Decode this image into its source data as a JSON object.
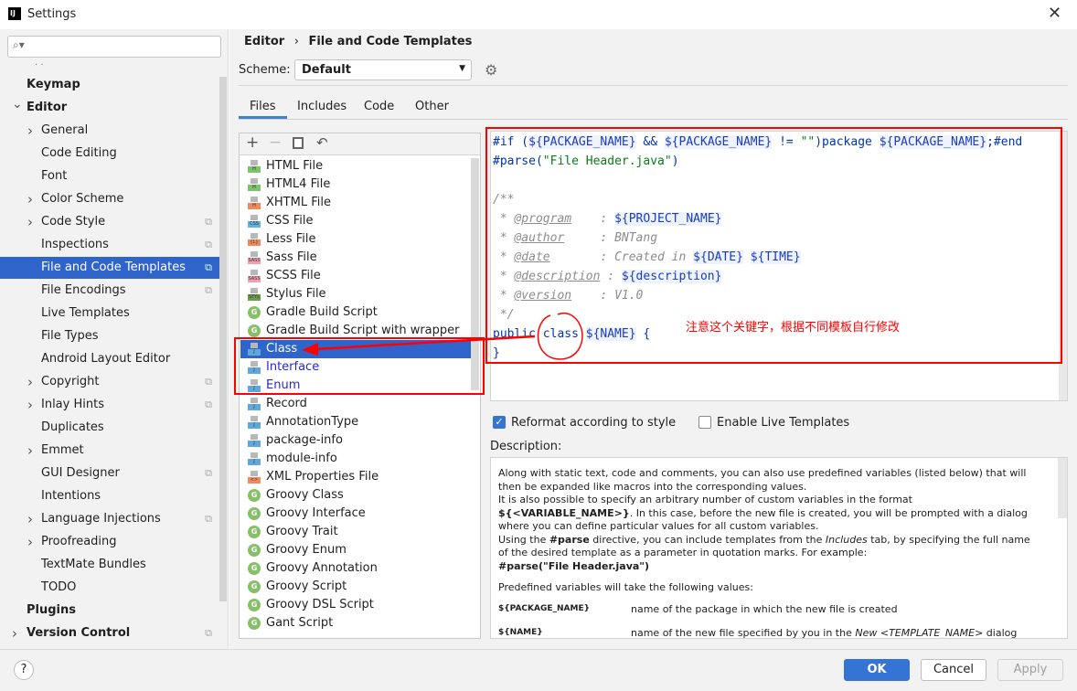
{
  "window": {
    "title": "Settings",
    "close_icon": "close-icon",
    "app_icon": "intellij-icon"
  },
  "search": {
    "placeholder": "",
    "icon": "search-icon"
  },
  "sidebar": {
    "items": [
      {
        "label": "Keymap",
        "bold": true,
        "level": 0
      },
      {
        "label": "Editor",
        "bold": true,
        "level": 0,
        "expanded": true
      },
      {
        "label": "General",
        "level": 1,
        "chevron": true
      },
      {
        "label": "Code Editing",
        "level": 1
      },
      {
        "label": "Font",
        "level": 1
      },
      {
        "label": "Color Scheme",
        "level": 1,
        "chevron": true
      },
      {
        "label": "Code Style",
        "level": 1,
        "chevron": true,
        "project": true
      },
      {
        "label": "Inspections",
        "level": 1,
        "project": true
      },
      {
        "label": "File and Code Templates",
        "level": 1,
        "project": true,
        "selected": true
      },
      {
        "label": "File Encodings",
        "level": 1,
        "project": true
      },
      {
        "label": "Live Templates",
        "level": 1
      },
      {
        "label": "File Types",
        "level": 1
      },
      {
        "label": "Android Layout Editor",
        "level": 1
      },
      {
        "label": "Copyright",
        "level": 1,
        "chevron": true,
        "project": true
      },
      {
        "label": "Inlay Hints",
        "level": 1,
        "chevron": true,
        "project": true
      },
      {
        "label": "Duplicates",
        "level": 1
      },
      {
        "label": "Emmet",
        "level": 1,
        "chevron": true
      },
      {
        "label": "GUI Designer",
        "level": 1,
        "project": true
      },
      {
        "label": "Intentions",
        "level": 1
      },
      {
        "label": "Language Injections",
        "level": 1,
        "chevron": true,
        "project": true
      },
      {
        "label": "Proofreading",
        "level": 1,
        "chevron": true
      },
      {
        "label": "TextMate Bundles",
        "level": 1
      },
      {
        "label": "TODO",
        "level": 1
      },
      {
        "label": "Plugins",
        "bold": true,
        "level": 0
      },
      {
        "label": "Version Control",
        "bold": true,
        "level": 0,
        "chevron": true,
        "project": true
      }
    ]
  },
  "breadcrumb": {
    "parent": "Editor",
    "separator": "›",
    "current": "File and Code Templates"
  },
  "scheme": {
    "label": "Scheme:",
    "value": "Default"
  },
  "tabs": [
    {
      "label": "Files",
      "active": true
    },
    {
      "label": "Includes"
    },
    {
      "label": "Code"
    },
    {
      "label": "Other"
    }
  ],
  "toolbar": {
    "add": "+",
    "remove": "−",
    "copy_icon": "copy-icon",
    "reset_icon": "undo-icon"
  },
  "templates": [
    {
      "label": "HTML File",
      "icon": "H",
      "color": "#7cc46a"
    },
    {
      "label": "HTML4 File",
      "icon": "H",
      "color": "#7cc46a"
    },
    {
      "label": "XHTML File",
      "icon": "H",
      "color": "#f08a5d"
    },
    {
      "label": "CSS File",
      "icon": "CSS",
      "color": "#5fb4d8"
    },
    {
      "label": "Less File",
      "icon": "{L}",
      "color": "#f08a5d"
    },
    {
      "label": "Sass File",
      "icon": "SASS",
      "color": "#f2a0b0"
    },
    {
      "label": "SCSS File",
      "icon": "SASS",
      "color": "#f2a0b0"
    },
    {
      "label": "Stylus File",
      "icon": "STYL",
      "color": "#6a9f4a"
    },
    {
      "label": "Gradle Build Script",
      "icon": "G",
      "type": "groovy"
    },
    {
      "label": "Gradle Build Script with wrapper",
      "icon": "G",
      "type": "groovy"
    },
    {
      "label": "Class",
      "icon": "J",
      "color": "#5fa8d8",
      "selected": true
    },
    {
      "label": "Interface",
      "icon": "J",
      "color": "#5fa8d8",
      "blue": true
    },
    {
      "label": "Enum",
      "icon": "J",
      "color": "#5fa8d8",
      "blue": true
    },
    {
      "label": "Record",
      "icon": "J",
      "color": "#5fa8d8"
    },
    {
      "label": "AnnotationType",
      "icon": "J",
      "color": "#5fa8d8"
    },
    {
      "label": "package-info",
      "icon": "J",
      "color": "#5fa8d8"
    },
    {
      "label": "module-info",
      "icon": "J",
      "color": "#5fa8d8"
    },
    {
      "label": "XML Properties File",
      "icon": "<>",
      "color": "#f08a5d"
    },
    {
      "label": "Groovy Class",
      "icon": "G",
      "type": "groovy"
    },
    {
      "label": "Groovy Interface",
      "icon": "G",
      "type": "groovy"
    },
    {
      "label": "Groovy Trait",
      "icon": "G",
      "type": "groovy"
    },
    {
      "label": "Groovy Enum",
      "icon": "G",
      "type": "groovy"
    },
    {
      "label": "Groovy Annotation",
      "icon": "G",
      "type": "groovy"
    },
    {
      "label": "Groovy Script",
      "icon": "G",
      "type": "groovy"
    },
    {
      "label": "Groovy DSL Script",
      "icon": "G",
      "type": "groovy"
    },
    {
      "label": "Gant Script",
      "icon": "G",
      "type": "groovy"
    }
  ],
  "editor": {
    "lines": [
      [
        [
          "kw",
          "#if ("
        ],
        [
          "var",
          "${PACKAGE_NAME}"
        ],
        [
          "kw",
          " && "
        ],
        [
          "var",
          "${PACKAGE_NAME}"
        ],
        [
          "kw",
          " != "
        ],
        [
          "str",
          "\"\""
        ],
        [
          "kw",
          ")package "
        ],
        [
          "var",
          "${PACKAGE_NAME}"
        ],
        [
          "kw",
          ";#end"
        ]
      ],
      [
        [
          "kw",
          "#parse("
        ],
        [
          "str",
          "\"File Header.java\""
        ],
        [
          "kw",
          ")"
        ]
      ],
      [],
      [
        [
          "cm",
          "/**"
        ]
      ],
      [
        [
          "cm",
          " * "
        ],
        [
          "cmt",
          "@program"
        ],
        [
          "cm",
          "    : "
        ],
        [
          "var",
          "${PROJECT_NAME}"
        ]
      ],
      [
        [
          "cm",
          " * "
        ],
        [
          "cmt",
          "@author"
        ],
        [
          "cm",
          "     : BNTang"
        ]
      ],
      [
        [
          "cm",
          " * "
        ],
        [
          "cmt",
          "@date"
        ],
        [
          "cm",
          "       : Created in "
        ],
        [
          "var",
          "${DATE}"
        ],
        [
          "cm",
          " "
        ],
        [
          "var",
          "${TIME}"
        ]
      ],
      [
        [
          "cm",
          " * "
        ],
        [
          "cmt",
          "@description"
        ],
        [
          "cm",
          " : "
        ],
        [
          "var",
          "${description}"
        ]
      ],
      [
        [
          "cm",
          " * "
        ],
        [
          "cmt",
          "@version"
        ],
        [
          "cm",
          "    : V1.0"
        ]
      ],
      [
        [
          "cm",
          " */"
        ]
      ],
      [
        [
          "kw",
          "public class "
        ],
        [
          "var",
          "${NAME}"
        ],
        [
          "kw",
          " {"
        ]
      ],
      [
        [
          "kw",
          "}"
        ]
      ]
    ]
  },
  "annotation": {
    "note": "注意这个关键字，根据不同模板自行修改",
    "color": "#ff0000"
  },
  "options": {
    "reformat": {
      "label": "Reformat according to style",
      "checked": true
    },
    "live_templates": {
      "label": "Enable Live Templates",
      "checked": false
    }
  },
  "description": {
    "label": "Description:",
    "p1": "Along with static text, code and comments, you can also use predefined variables (listed below) that will then be expanded like macros into the corresponding values.",
    "p2a": "It is also possible to specify an arbitrary number of custom variables in the format",
    "p2b": "${<VARIABLE_NAME>}",
    "p2c": ". In this case, before the new file is created, you will be prompted with a dialog where you can define particular values for all custom variables.",
    "p3a": "Using the ",
    "p3b": "#parse",
    "p3c": " directive, you can include templates from the ",
    "p3d": "Includes",
    "p3e": " tab, by specifying the full name of the desired template as a parameter in quotation marks. For example:",
    "p4": "#parse(\"File Header.java\")",
    "p5": "Predefined variables will take the following values:",
    "vars": [
      {
        "name": "${PACKAGE_NAME}",
        "desc": "name of the package in which the new file is created"
      },
      {
        "name": "${NAME}",
        "desc_a": "name of the new file specified by you in the ",
        "desc_b": "New <TEMPLATE_NAME>",
        "desc_c": " dialog"
      }
    ]
  },
  "footer": {
    "help": "?",
    "ok": "OK",
    "cancel": "Cancel",
    "apply": "Apply"
  },
  "colors": {
    "accent": "#2f65ca",
    "ok_button": "#3574d4",
    "annotation": "#ff0000"
  }
}
